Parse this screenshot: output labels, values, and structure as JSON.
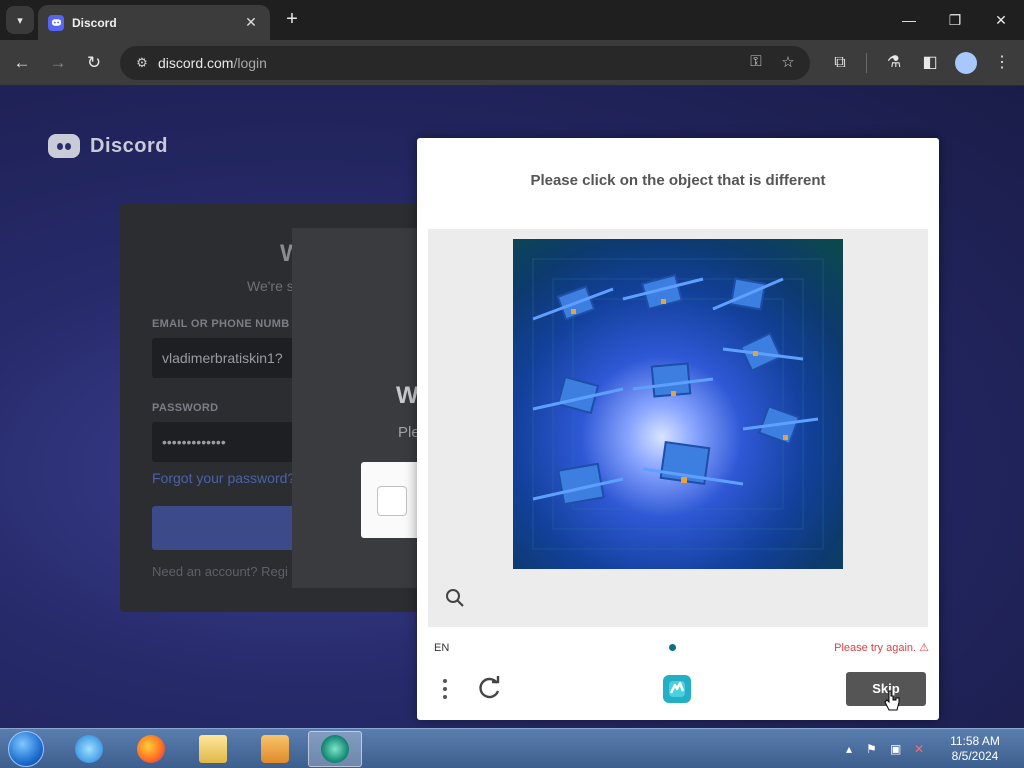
{
  "browser": {
    "tab_title": "Discord",
    "tab_close": "✕",
    "new_tab": "+",
    "url_host": "discord.com",
    "url_path": "/login",
    "window_minimize": "—",
    "window_restore": "❐",
    "window_close": "✕"
  },
  "discord": {
    "brand": "Discord",
    "welcome_title": "W",
    "welcome_subtitle": "We're s",
    "email_label": "EMAIL OR PHONE NUMB",
    "email_value": "vladimerbratiskin1?",
    "password_label": "PASSWORD",
    "password_value": "•••••••••••••",
    "forgot_link": "Forgot your password?",
    "need_account": "Need an account? Regi"
  },
  "verify_modal": {
    "title": "W",
    "subtitle": "Ple"
  },
  "captcha": {
    "prompt": "Please click on the object that is different",
    "language": "EN",
    "error": "Please try again. ⚠",
    "skip_label": "Skip"
  },
  "taskbar": {
    "time": "11:58 AM",
    "date": "8/5/2024"
  },
  "colors": {
    "discord_blurple": "#5865f2",
    "captcha_error": "#d64545",
    "skip_button": "#555555"
  }
}
